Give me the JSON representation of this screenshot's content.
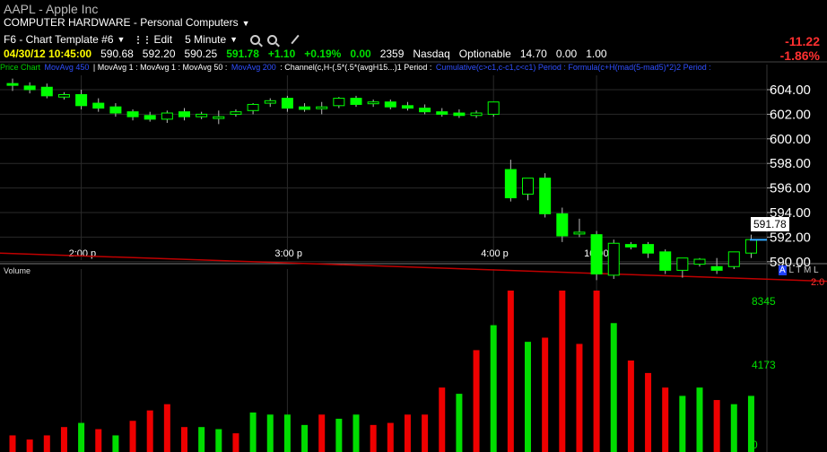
{
  "header": {
    "title": "AAPL - Apple Inc",
    "category": "COMPUTER HARDWARE - Personal Computers"
  },
  "toolbar": {
    "template": "F6 - Chart Template #6",
    "edit": "Edit",
    "interval": "5 Minute",
    "icons": [
      "zoom-in-icon",
      "zoom-out-icon",
      "pencil-icon"
    ]
  },
  "quote": {
    "datetime": "04/30/12 10:45:00",
    "open": "590.68",
    "high": "592.20",
    "low": "590.25",
    "last": "591.78",
    "change": "+1.10",
    "pct": "+0.19%",
    "vol_change": "0.00",
    "volume": "2359",
    "exchange": "Nasdaq",
    "optionable": "Optionable",
    "val1": "14.70",
    "val2": "0.00",
    "val3": "1.00",
    "day_change": "-11.22",
    "day_pct": "-1.86%"
  },
  "studies": [
    {
      "text": "Price Chart",
      "color": "#00d000"
    },
    {
      "text": "MovAvg 450",
      "color": "#3050ff"
    },
    {
      "text": "| MovAvg 1 : MovAvg 1 : MovAvg 50 :",
      "color": "#ffffff"
    },
    {
      "text": "MovAvg 200",
      "color": "#3050ff"
    },
    {
      "text": ": Channel(c,H-(.5*(.5*(avgH15...)1 Period :",
      "color": "#ffffff"
    },
    {
      "text": "Cumulative(c>c1,c-c1,c<c1) Period : Formula(c+H(mad(5-mad5)*2)2 Period :",
      "color": "#3050ff"
    }
  ],
  "last_price_label": "591.78",
  "axis_extra": {
    "altml": "A L T M L",
    "sub_value": "2.0"
  },
  "chart_data": {
    "type": "candlestick",
    "price_axis": {
      "ticks": [
        "604.00",
        "602.00",
        "600.00",
        "598.00",
        "596.00",
        "594.00",
        "592.00",
        "590.00"
      ],
      "values": [
        604,
        602,
        600,
        598,
        596,
        594,
        592,
        590
      ],
      "ylim": [
        588.3,
        605.3
      ]
    },
    "time_labels": [
      {
        "label": "2:00 p",
        "index": 4
      },
      {
        "label": "3:00 p",
        "index": 16
      },
      {
        "label": "4:00 p",
        "index": 28
      },
      {
        "label": "10:00 a",
        "index": 34
      }
    ],
    "candles": [
      {
        "o": 604.5,
        "h": 604.9,
        "c": 604.4,
        "l": 603.9
      },
      {
        "o": 604.3,
        "h": 604.6,
        "c": 604.0,
        "l": 603.7
      },
      {
        "o": 604.2,
        "h": 604.5,
        "c": 603.5,
        "l": 603.3
      },
      {
        "o": 603.4,
        "h": 603.8,
        "c": 603.6,
        "l": 603.2
      },
      {
        "o": 603.6,
        "h": 604.0,
        "c": 602.7,
        "l": 602.4
      },
      {
        "o": 602.9,
        "h": 603.3,
        "c": 602.5,
        "l": 602.2
      },
      {
        "o": 602.6,
        "h": 602.9,
        "c": 602.1,
        "l": 601.8
      },
      {
        "o": 602.2,
        "h": 602.4,
        "c": 601.8,
        "l": 601.5
      },
      {
        "o": 601.9,
        "h": 602.2,
        "c": 601.6,
        "l": 601.4
      },
      {
        "o": 601.6,
        "h": 602.3,
        "c": 602.1,
        "l": 601.3
      },
      {
        "o": 602.2,
        "h": 602.5,
        "c": 601.8,
        "l": 601.5
      },
      {
        "o": 601.8,
        "h": 602.2,
        "c": 602.0,
        "l": 601.6
      },
      {
        "o": 601.7,
        "h": 602.3,
        "c": 601.8,
        "l": 601.2
      },
      {
        "o": 602.0,
        "h": 602.4,
        "c": 602.2,
        "l": 601.8
      },
      {
        "o": 602.3,
        "h": 602.9,
        "c": 602.8,
        "l": 602.0
      },
      {
        "o": 602.9,
        "h": 603.3,
        "c": 603.1,
        "l": 602.6
      },
      {
        "o": 603.3,
        "h": 603.5,
        "c": 602.5,
        "l": 602.2
      },
      {
        "o": 602.6,
        "h": 602.9,
        "c": 602.4,
        "l": 602.2
      },
      {
        "o": 602.5,
        "h": 603.0,
        "c": 602.6,
        "l": 602.0
      },
      {
        "o": 602.7,
        "h": 603.4,
        "c": 603.3,
        "l": 602.5
      },
      {
        "o": 603.3,
        "h": 603.5,
        "c": 602.8,
        "l": 602.6
      },
      {
        "o": 602.9,
        "h": 603.2,
        "c": 603.0,
        "l": 602.6
      },
      {
        "o": 603.0,
        "h": 603.2,
        "c": 602.6,
        "l": 602.4
      },
      {
        "o": 602.7,
        "h": 603.0,
        "c": 602.5,
        "l": 602.3
      },
      {
        "o": 602.5,
        "h": 602.8,
        "c": 602.2,
        "l": 602.0
      },
      {
        "o": 602.2,
        "h": 602.5,
        "c": 602.0,
        "l": 601.8
      },
      {
        "o": 602.1,
        "h": 602.4,
        "c": 601.9,
        "l": 601.7
      },
      {
        "o": 601.9,
        "h": 602.3,
        "c": 602.1,
        "l": 601.7
      },
      {
        "o": 602.0,
        "h": 603.0,
        "c": 603.0,
        "l": 601.8
      },
      {
        "o": 597.5,
        "h": 598.3,
        "c": 595.2,
        "l": 594.9
      },
      {
        "o": 595.5,
        "h": 596.5,
        "c": 596.8,
        "l": 595.0
      },
      {
        "o": 596.8,
        "h": 597.2,
        "c": 593.9,
        "l": 593.6
      },
      {
        "o": 593.9,
        "h": 594.4,
        "c": 592.1,
        "l": 591.6
      },
      {
        "o": 592.4,
        "h": 593.5,
        "c": 592.4,
        "l": 592.0
      },
      {
        "o": 592.2,
        "h": 592.5,
        "c": 589.0,
        "l": 588.5
      },
      {
        "o": 588.9,
        "h": 591.8,
        "c": 591.5,
        "l": 588.6
      },
      {
        "o": 591.4,
        "h": 591.6,
        "c": 591.2,
        "l": 591.0
      },
      {
        "o": 591.4,
        "h": 591.6,
        "c": 590.7,
        "l": 590.3
      },
      {
        "o": 590.8,
        "h": 591.0,
        "c": 589.3,
        "l": 589.0
      },
      {
        "o": 589.3,
        "h": 590.3,
        "c": 590.3,
        "l": 588.7
      },
      {
        "o": 589.8,
        "h": 590.3,
        "c": 590.2,
        "l": 589.6
      },
      {
        "o": 589.6,
        "h": 590.3,
        "c": 589.3,
        "l": 589.0
      },
      {
        "o": 589.6,
        "h": 590.8,
        "c": 590.8,
        "l": 589.4
      },
      {
        "o": 590.7,
        "h": 592.2,
        "c": 591.8,
        "l": 590.3
      }
    ],
    "moving_average_line": [
      {
        "x": 0,
        "y": 590.7
      },
      {
        "x": 43,
        "y": 588.7
      }
    ],
    "volume": {
      "label": "Volume",
      "ticks": [
        "8345",
        "4173",
        "0"
      ],
      "tick_values": [
        8345,
        4173,
        0
      ],
      "ylim": [
        0,
        8800
      ],
      "bars": [
        {
          "v": 800,
          "c": "r"
        },
        {
          "v": 600,
          "c": "r"
        },
        {
          "v": 800,
          "c": "r"
        },
        {
          "v": 1200,
          "c": "r"
        },
        {
          "v": 1400,
          "c": "g"
        },
        {
          "v": 1100,
          "c": "r"
        },
        {
          "v": 800,
          "c": "g"
        },
        {
          "v": 1500,
          "c": "r"
        },
        {
          "v": 2000,
          "c": "r"
        },
        {
          "v": 2300,
          "c": "r"
        },
        {
          "v": 1200,
          "c": "r"
        },
        {
          "v": 1200,
          "c": "g"
        },
        {
          "v": 1100,
          "c": "g"
        },
        {
          "v": 900,
          "c": "r"
        },
        {
          "v": 1900,
          "c": "g"
        },
        {
          "v": 1800,
          "c": "g"
        },
        {
          "v": 1800,
          "c": "g"
        },
        {
          "v": 1300,
          "c": "g"
        },
        {
          "v": 1800,
          "c": "r"
        },
        {
          "v": 1600,
          "c": "g"
        },
        {
          "v": 1800,
          "c": "g"
        },
        {
          "v": 1300,
          "c": "r"
        },
        {
          "v": 1400,
          "c": "r"
        },
        {
          "v": 1800,
          "c": "r"
        },
        {
          "v": 1800,
          "c": "r"
        },
        {
          "v": 3100,
          "c": "r"
        },
        {
          "v": 2800,
          "c": "g"
        },
        {
          "v": 4900,
          "c": "r"
        },
        {
          "v": 6100,
          "c": "g"
        },
        {
          "v": 9200,
          "c": "r"
        },
        {
          "v": 5300,
          "c": "g"
        },
        {
          "v": 5500,
          "c": "r"
        },
        {
          "v": 7900,
          "c": "r"
        },
        {
          "v": 5200,
          "c": "r"
        },
        {
          "v": 9200,
          "c": "r"
        },
        {
          "v": 6200,
          "c": "g"
        },
        {
          "v": 4400,
          "c": "r"
        },
        {
          "v": 3800,
          "c": "r"
        },
        {
          "v": 3100,
          "c": "r"
        },
        {
          "v": 2700,
          "c": "g"
        },
        {
          "v": 3100,
          "c": "g"
        },
        {
          "v": 2500,
          "c": "r"
        },
        {
          "v": 2300,
          "c": "g"
        },
        {
          "v": 2700,
          "c": "g"
        }
      ]
    }
  }
}
